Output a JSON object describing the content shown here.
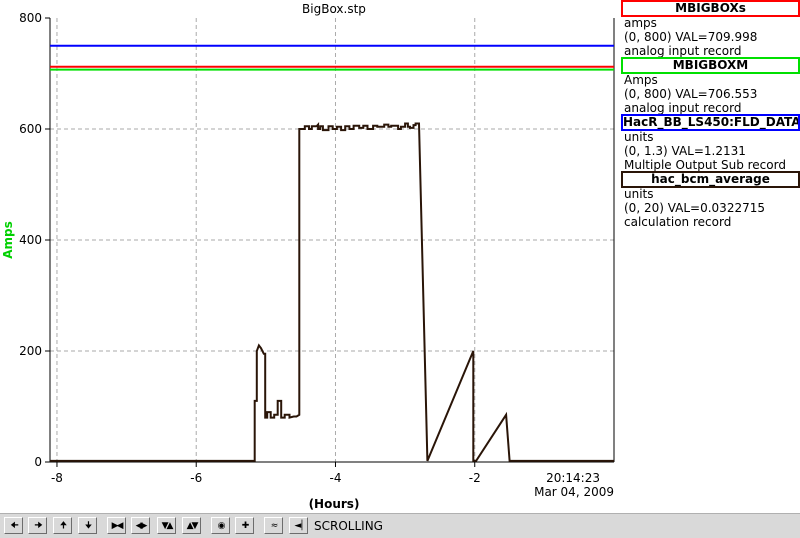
{
  "chart_data": {
    "type": "line",
    "title": "BigBox.stp",
    "xlabel": "(Hours)",
    "ylabel": "Amps",
    "xlim": [
      -8.1,
      0
    ],
    "ylim": [
      0,
      800
    ],
    "x_ticks": [
      -8,
      -6,
      -4,
      -2
    ],
    "y_ticks": [
      0,
      200,
      400,
      600,
      800
    ],
    "grid": true,
    "timestamp": [
      "20:14:23",
      "Mar 04, 2009"
    ],
    "series": [
      {
        "name": "MBIGBOXs",
        "color": "#ff0000",
        "x": [
          -8.1,
          0
        ],
        "y": [
          712,
          712
        ]
      },
      {
        "name": "MBIGBOXM",
        "color": "#00e000",
        "x": [
          -8.1,
          0
        ],
        "y": [
          707,
          707
        ]
      },
      {
        "name": "HacR_BB_LS450:FLD_DATA",
        "color": "#0000ff",
        "x": [
          -8.1,
          0
        ],
        "y": [
          750,
          750
        ]
      },
      {
        "name": "hac_bcm_average",
        "color": "#2a1508",
        "x": [
          -8.1,
          -5.16,
          -5.16,
          -5.13,
          -5.13,
          -5.1,
          -5.07,
          -5.03,
          -5.01,
          -5.01,
          -4.98,
          -4.98,
          -4.93,
          -4.93,
          -4.88,
          -4.88,
          -4.83,
          -4.83,
          -4.78,
          -4.78,
          -4.73,
          -4.73,
          -4.66,
          -4.66,
          -4.6,
          -4.56,
          -4.52,
          -4.52,
          -4.44,
          -4.44,
          -4.38,
          -4.38,
          -4.34,
          -4.34,
          -4.27,
          -4.25,
          -4.25,
          -4.22,
          -4.22,
          -4.18,
          -4.18,
          -4.1,
          -4.1,
          -4.04,
          -4.04,
          -3.98,
          -3.98,
          -3.92,
          -3.92,
          -3.86,
          -3.86,
          -3.8,
          -3.8,
          -3.74,
          -3.74,
          -3.66,
          -3.66,
          -3.6,
          -3.6,
          -3.54,
          -3.54,
          -3.46,
          -3.46,
          -3.4,
          -3.4,
          -3.3,
          -3.3,
          -3.24,
          -3.24,
          -3.2,
          -3.2,
          -3.1,
          -3.1,
          -3.06,
          -3.06,
          -3.0,
          -3.0,
          -2.96,
          -2.96,
          -2.93,
          -2.93,
          -2.88,
          -2.88,
          -2.85,
          -2.85,
          -2.8,
          -2.68,
          -2.68,
          -2.02,
          -2.02,
          -1.98,
          -1.98,
          -1.55,
          -1.55,
          -1.5,
          -1.5,
          0
        ],
        "y": [
          2,
          2,
          110,
          110,
          200,
          210,
          205,
          195,
          195,
          80,
          80,
          90,
          90,
          80,
          80,
          85,
          85,
          110,
          110,
          80,
          80,
          85,
          85,
          80,
          82,
          82,
          85,
          600,
          600,
          605,
          605,
          600,
          600,
          605,
          605,
          608,
          600,
          600,
          605,
          605,
          598,
          598,
          605,
          605,
          600,
          600,
          604,
          604,
          598,
          598,
          605,
          605,
          600,
          600,
          606,
          606,
          602,
          602,
          606,
          606,
          600,
          600,
          606,
          606,
          604,
          604,
          608,
          608,
          604,
          604,
          606,
          606,
          600,
          600,
          604,
          604,
          610,
          610,
          604,
          604,
          602,
          602,
          607,
          607,
          610,
          610,
          2,
          2,
          200,
          2,
          2,
          2,
          85,
          85,
          2,
          2,
          2
        ]
      }
    ]
  },
  "legend": [
    {
      "name": "MBIGBOXs",
      "border_color": "#ff0000",
      "units": "amps",
      "range_value": "(0, 800) VAL=709.998",
      "record": "analog input record"
    },
    {
      "name": "MBIGBOXM",
      "border_color": "#00e000",
      "units": "Amps",
      "range_value": "(0, 800) VAL=706.553",
      "record": "analog input record"
    },
    {
      "name": "HacR_BB_LS450:FLD_DATA",
      "border_color": "#0000ff",
      "units": "units",
      "range_value": "(0, 1.3) VAL=1.2131",
      "record": "Multiple Output Sub record"
    },
    {
      "name": "hac_bcm_average",
      "border_color": "#2a1508",
      "units": "units",
      "range_value": "(0, 20) VAL=0.0322715",
      "record": "calculation record"
    }
  ],
  "toolbar": {
    "icons": [
      "arrow-left-icon",
      "arrow-right-icon",
      "arrow-up-icon",
      "arrow-down-icon",
      "zoom-in-horizontal-icon",
      "zoom-out-horizontal-icon",
      "zoom-in-vertical-icon",
      "zoom-out-vertical-icon",
      "circle-icon",
      "plus-icon",
      "autoscale-icon",
      "scroll-mode-icon"
    ],
    "mode_label": "SCROLLING"
  }
}
